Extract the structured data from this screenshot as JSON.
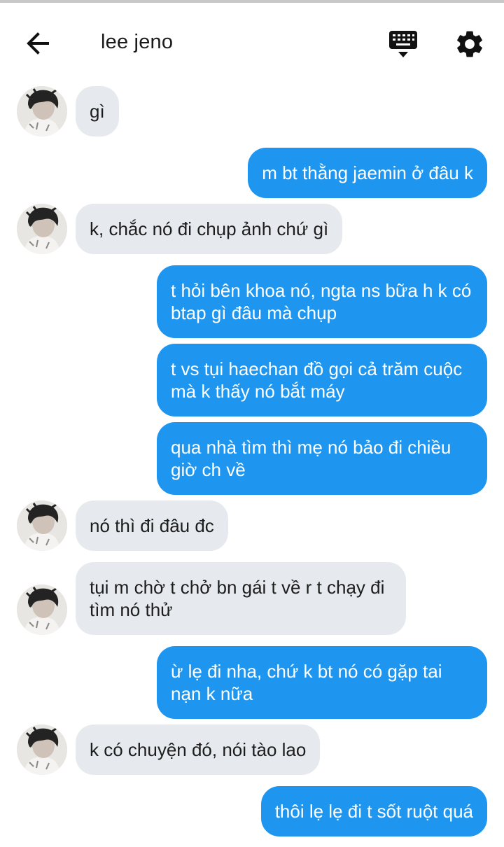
{
  "header": {
    "back_icon": "arrow-left-icon",
    "title": "lee jeno",
    "keyboard_icon": "keyboard-icon",
    "settings_icon": "gear-icon"
  },
  "colors": {
    "outgoing_bubble": "#1e96f0",
    "incoming_bubble": "#e6e9ed",
    "background": "#ffffff"
  },
  "messages": [
    {
      "from": "lee jeno",
      "text": "gì"
    },
    {
      "from": "me",
      "text": "m bt thằng jaemin ở đâu k"
    },
    {
      "from": "lee jeno",
      "text": "k, chắc nó đi chụp ảnh chứ gì"
    },
    {
      "from": "me",
      "text": "t hỏi bên khoa nó, ngta ns bữa h k có btap gì đâu mà chụp"
    },
    {
      "from": "me",
      "text": "t vs tụi haechan đồ gọi cả trăm cuộc mà k thấy nó bắt máy"
    },
    {
      "from": "me",
      "text": "qua nhà tìm thì mẹ nó bảo đi chiều giờ ch về"
    },
    {
      "from": "lee jeno",
      "text": "nó thì đi đâu đc"
    },
    {
      "from": "lee jeno",
      "text": "tụi m chờ t chở bn gái t về r t chạy đi tìm nó thử"
    },
    {
      "from": "me",
      "text": "ừ lẹ đi nha, chứ k bt nó có gặp tai nạn k nữa"
    },
    {
      "from": "lee jeno",
      "text": "k có chuyện đó, nói tào lao"
    },
    {
      "from": "me",
      "text": "thôi lẹ lẹ đi t sốt ruột quá"
    }
  ]
}
